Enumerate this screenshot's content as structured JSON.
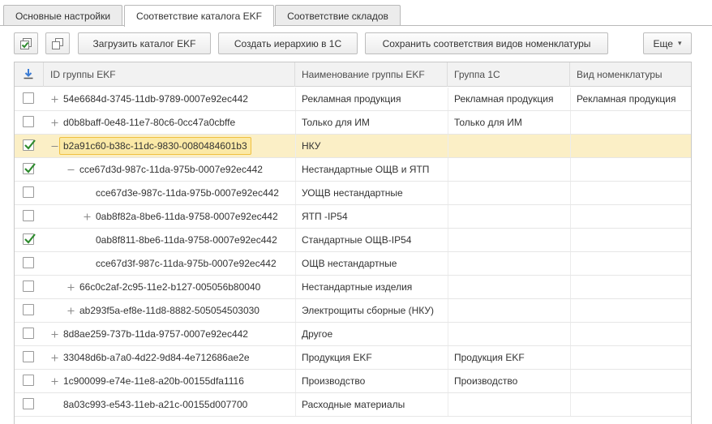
{
  "tabs": [
    {
      "label": "Основные настройки",
      "active": false
    },
    {
      "label": "Соответствие каталога EKF",
      "active": true
    },
    {
      "label": "Соответствие складов",
      "active": false
    }
  ],
  "toolbar": {
    "check_all_icon": "check-all-icon",
    "copy_icon": "copy-icon",
    "load_catalog": "Загрузить каталог EKF",
    "create_hierarchy": "Создать иерархию в 1С",
    "save_mapping": "Сохранить соответствия видов номенклатуры",
    "more": "Еще",
    "more_arrow": "▾"
  },
  "table": {
    "headers": {
      "mark_icon": "download-icon",
      "id": "ID группы EKF",
      "name": "Наименование группы EKF",
      "group1c": "Группа 1С",
      "kind": "Вид номенклатуры"
    },
    "rows": [
      {
        "checked": false,
        "level": 0,
        "expander": "plus",
        "id": "54e6684d-3745-11db-9789-0007e92ec442",
        "name": "Рекламная продукция",
        "group1c": "Рекламная продукция",
        "kind": "Рекламная продукция",
        "selected": false
      },
      {
        "checked": false,
        "level": 0,
        "expander": "plus",
        "id": "d0b8baff-0e48-11e7-80c6-0cc47a0cbffe",
        "name": "Только для ИМ",
        "group1c": "Только для ИМ",
        "kind": "",
        "selected": false
      },
      {
        "checked": true,
        "level": 0,
        "expander": "minus",
        "id": "b2a91c60-b38c-11dc-9830-0080484601b3",
        "name": "НКУ",
        "group1c": "",
        "kind": "",
        "selected": true
      },
      {
        "checked": true,
        "level": 1,
        "expander": "minus",
        "id": "cce67d3d-987c-11da-975b-0007e92ec442",
        "name": "Нестандартные ОЩВ и ЯТП",
        "group1c": "",
        "kind": "",
        "selected": false
      },
      {
        "checked": false,
        "level": 2,
        "expander": "none",
        "id": "cce67d3e-987c-11da-975b-0007e92ec442",
        "name": "УОЩВ нестандартные",
        "group1c": "",
        "kind": "",
        "selected": false
      },
      {
        "checked": false,
        "level": 2,
        "expander": "plus",
        "id": "0ab8f82a-8be6-11da-9758-0007e92ec442",
        "name": "ЯТП -IP54",
        "group1c": "",
        "kind": "",
        "selected": false
      },
      {
        "checked": true,
        "level": 2,
        "expander": "none",
        "id": "0ab8f811-8be6-11da-9758-0007e92ec442",
        "name": "Стандартные ОЩВ-IP54",
        "group1c": "",
        "kind": "",
        "selected": false
      },
      {
        "checked": false,
        "level": 2,
        "expander": "none",
        "id": "cce67d3f-987c-11da-975b-0007e92ec442",
        "name": "ОЩВ нестандартные",
        "group1c": "",
        "kind": "",
        "selected": false
      },
      {
        "checked": false,
        "level": 1,
        "expander": "plus",
        "id": "66c0c2af-2c95-11e2-b127-005056b80040",
        "name": "Нестандартные изделия",
        "group1c": "",
        "kind": "",
        "selected": false
      },
      {
        "checked": false,
        "level": 1,
        "expander": "plus",
        "id": "ab293f5a-ef8e-11d8-8882-505054503030",
        "name": "Электрощиты сборные (НКУ)",
        "group1c": "",
        "kind": "",
        "selected": false
      },
      {
        "checked": false,
        "level": 0,
        "expander": "plus",
        "id": "8d8ae259-737b-11da-9757-0007e92ec442",
        "name": "Другое",
        "group1c": "",
        "kind": "",
        "selected": false
      },
      {
        "checked": false,
        "level": 0,
        "expander": "plus",
        "id": "33048d6b-a7a0-4d22-9d84-4e712686ae2e",
        "name": "Продукция EKF",
        "group1c": "Продукция EKF",
        "kind": "",
        "selected": false
      },
      {
        "checked": false,
        "level": 0,
        "expander": "plus",
        "id": "1c900099-e74e-11e8-a20b-00155dfa1116",
        "name": "Производство",
        "group1c": "Производство",
        "kind": "",
        "selected": false
      },
      {
        "checked": false,
        "level": 0,
        "expander": "none",
        "id": "8a03c993-e543-11eb-a21c-00155d007700",
        "name": "Расходные материалы",
        "group1c": "",
        "kind": "",
        "selected": false
      }
    ]
  },
  "colors": {
    "selected_row": "#fbefc6",
    "focused_cell": "#fbe9a6",
    "check": "#2e8b2e",
    "border": "#c8c8c8"
  }
}
